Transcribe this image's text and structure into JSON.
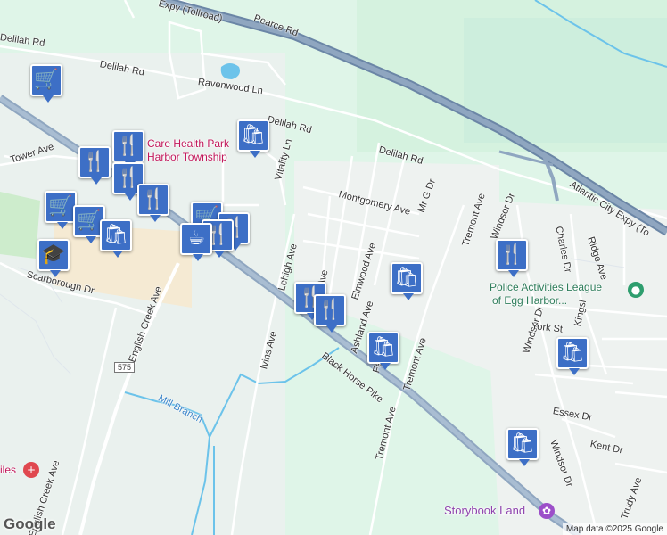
{
  "map": {
    "roads": {
      "tollroad": "Expy (Tollroad)",
      "pearce": "Pearce Rd",
      "delilah_1": "Delilah Rd",
      "delilah_2": "Delilah Rd",
      "delilah_3": "Delilah Rd",
      "delilah_4": "Delilah Rd",
      "ravenwood": "Ravenwood Ln",
      "tower": "Tower Ave",
      "vitality": "Vitality Ln",
      "montgomery": "Montgomery Ave",
      "mr_g": "Mr G Dr",
      "tremont_1": "Tremont Ave",
      "tremont_2": "Tremont Ave",
      "tremont_3": "Tremont Ave",
      "windsor_1": "Windsor Dr",
      "windsor_2": "Windsor Dr",
      "windsor_3": "Windsor Dr",
      "charles": "Charles Dr",
      "ridge": "Ridge Ave",
      "atlantic": "Atlantic City Expy (To",
      "lehigh": "Lehigh Ave",
      "ave_short": "Ave",
      "elmwood": "Elmwood Ave",
      "ashland": "Ashland Ave",
      "fe_ave": "Fe     Ave",
      "ivins": "Ivins Ave",
      "black_horse": "Black Horse Pike",
      "english_creek_1": "English Creek Ave",
      "english_creek_2": "English Creek Ave",
      "scarborough": "Scarborough Dr",
      "york": "York St",
      "kingsl": "Kingsl",
      "essex": "Essex Dr",
      "kent": "Kent Dr",
      "trudy": "Trudy Ave",
      "route_575": "575"
    },
    "water": {
      "mill_branch": "Mill Branch"
    },
    "places": {
      "health_park_1": "Care Health Park",
      "health_park_2": "Harbor Township",
      "police_league_1": "Police Activities League",
      "police_league_2": "of Egg Harbor...",
      "storybook": "Storybook Land",
      "iles": "iles"
    },
    "pins": [
      {
        "icon": "shopping-cart",
        "glyph": "🛒"
      },
      {
        "icon": "shopping-bag",
        "glyph": "🛍"
      },
      {
        "icon": "fork-knife",
        "glyph": "🍴"
      },
      {
        "icon": "fork-knife",
        "glyph": "🍴"
      },
      {
        "icon": "fork-knife",
        "glyph": "🍴"
      },
      {
        "icon": "fork-knife",
        "glyph": "🍴"
      },
      {
        "icon": "shopping-cart",
        "glyph": "🛒"
      },
      {
        "icon": "shopping-cart",
        "glyph": "🛒"
      },
      {
        "icon": "shopping-bag",
        "glyph": "🛍"
      },
      {
        "icon": "school",
        "glyph": "🎓"
      },
      {
        "icon": "shopping-cart",
        "glyph": "🛒"
      },
      {
        "icon": "fork-knife",
        "glyph": "🍴"
      },
      {
        "icon": "fork-knife",
        "glyph": "🍴"
      },
      {
        "icon": "coffee-cup",
        "glyph": "☕"
      },
      {
        "icon": "fork-knife",
        "glyph": "🍴"
      },
      {
        "icon": "fork-knife",
        "glyph": "🍴"
      },
      {
        "icon": "shopping-bag",
        "glyph": "🛍"
      },
      {
        "icon": "shopping-bag",
        "glyph": "🛍"
      },
      {
        "icon": "fork-knife",
        "glyph": "🍴"
      },
      {
        "icon": "shopping-bag",
        "glyph": "🛍"
      },
      {
        "icon": "shopping-bag",
        "glyph": "🛍"
      }
    ],
    "colors": {
      "land": "#dff5e8",
      "highway": "#8fa6c0",
      "pin": "#3d6fc6",
      "water": "#6cc3ea",
      "commercial": "#f5ead3"
    },
    "logo": "Google",
    "attribution": "Map data ©2025 Google"
  }
}
